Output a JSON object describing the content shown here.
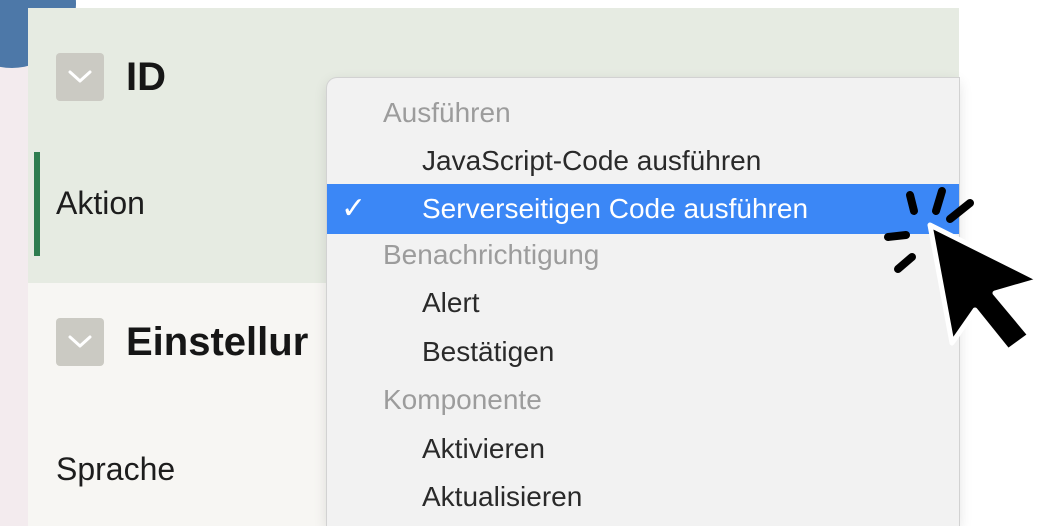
{
  "sections": [
    {
      "title": "ID",
      "field": "Aktion"
    },
    {
      "title": "Einstellur",
      "field": "Sprache"
    }
  ],
  "menu": {
    "groups": [
      {
        "label": "Ausführen",
        "items": [
          "JavaScript-Code ausführen",
          "Serverseitigen Code ausführen"
        ]
      },
      {
        "label": "Benachrichtigung",
        "items": [
          "Alert",
          "Bestätigen"
        ]
      },
      {
        "label": "Komponente",
        "items": [
          "Aktivieren",
          "Aktualisieren"
        ]
      }
    ],
    "selected_check": "✓"
  },
  "colors": {
    "accent": "#2e7d4f",
    "selection": "#3b87f6",
    "corner_circle": "#4d78a8"
  },
  "icons": [
    "chevron-down-icon",
    "checkmark-icon",
    "pointer-cursor-icon"
  ]
}
